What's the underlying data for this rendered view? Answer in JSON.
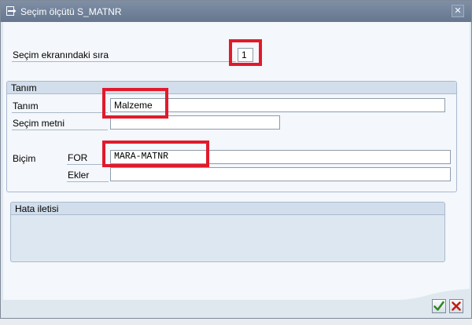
{
  "window": {
    "title": "Seçim ölçütü S_MATNR",
    "close_label": "✕"
  },
  "form": {
    "order_label": "Seçim ekranındaki sıra",
    "order_value": "1"
  },
  "tanim_group": {
    "title": "Tanım",
    "tanim_label": "Tanım",
    "tanim_value": "Malzeme",
    "secim_metni_label": "Seçim metni",
    "secim_metni_value": "",
    "bicim_label": "Biçim",
    "for_label": "FOR",
    "for_value": "MARA-MATNR",
    "ekler_label": "Ekler",
    "ekler_value": ""
  },
  "error_group": {
    "title": "Hata iletisi"
  },
  "icons": {
    "title_icon": "select-option-icon",
    "ok_icon": "green-check-icon",
    "cancel_icon": "red-x-icon"
  },
  "colors": {
    "highlight": "#e11a2b",
    "titlebar": "#6f8198",
    "ok": "#2f8a1c",
    "cancel": "#c21e12"
  }
}
